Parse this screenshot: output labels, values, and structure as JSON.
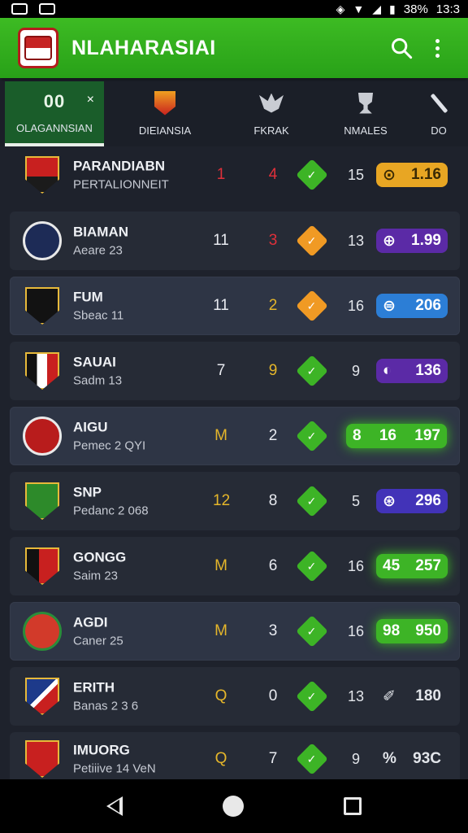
{
  "status_bar": {
    "battery": "38%",
    "time": "13:3"
  },
  "app_bar": {
    "title": "NLAHARASIAI"
  },
  "tabs": [
    {
      "label": "OLAGANNSIAN",
      "badge": "00",
      "close": "×"
    },
    {
      "label": "DIEIANSIA"
    },
    {
      "label": "FKRAK"
    },
    {
      "label": "NMALES"
    },
    {
      "label": "DO"
    }
  ],
  "rows": [
    {
      "name": "PARANDIABN",
      "sub": "PERTALIONNEIT",
      "c1": "1",
      "c2": "4",
      "diamond_glyph": "✓",
      "c3": "15",
      "pill_icon": "⊙",
      "pill_value": "1.16",
      "pill_color": "#e8a623"
    },
    {
      "name": "BIAMAN",
      "sub": "Aeare 23",
      "c1": "11",
      "c2": "3",
      "diamond_glyph": "✓",
      "c3": "13",
      "pill_icon": "⊕",
      "pill_value": "1.99",
      "pill_color": "#5b2aa6"
    },
    {
      "name": "FUM",
      "sub": "Sbeac 11",
      "c1": "11",
      "c2": "2",
      "diamond_glyph": "✓",
      "c3": "16",
      "pill_icon": "⊜",
      "pill_value": "206",
      "pill_color": "#2c7ed6"
    },
    {
      "name": "SAUAI",
      "sub": "Sadm 13",
      "c1": "7",
      "c2": "9",
      "diamond_glyph": "✓",
      "c3": "9",
      "pill_icon": "◐",
      "pill_value": "136",
      "pill_color": "#5b2aa6"
    },
    {
      "name": "AIGU",
      "sub": "Pemec 2 QYI",
      "c1": "M",
      "c2": "2",
      "diamond_glyph": "✓",
      "c3": "",
      "pill_icon": "8",
      "pill_mid": "16",
      "pill_value": "197",
      "pill_color": "#3db426"
    },
    {
      "name": "SNP",
      "sub": "Pedanc 2 068",
      "c1": "12",
      "c2": "8",
      "diamond_glyph": "✓",
      "c3": "5",
      "pill_icon": "⊛",
      "pill_value": "296",
      "pill_color": "#4233b8"
    },
    {
      "name": "GONGG",
      "sub": "Saim 23",
      "c1": "M",
      "c2": "6",
      "diamond_glyph": "✓",
      "c3": "16",
      "pill_icon": "45",
      "pill_value": "257",
      "pill_color": "#3db426"
    },
    {
      "name": "AGDI",
      "sub": "Caner 25",
      "c1": "M",
      "c2": "3",
      "diamond_glyph": "✓",
      "c3": "16",
      "pill_icon": "98",
      "pill_value": "950",
      "pill_color": "#3db426"
    },
    {
      "name": "ERITH",
      "sub": "Banas 2 3 6",
      "c1": "Q",
      "c2": "0",
      "diamond_glyph": "✓",
      "c3": "13",
      "pill_icon": "✐",
      "pill_value": "180",
      "pill_color": ""
    },
    {
      "name": "IMUORG",
      "sub": "Petiiive 14 VeN",
      "c1": "Q",
      "c2": "7",
      "diamond_glyph": "✓",
      "c3": "9",
      "pill_icon": "%",
      "pill_value": "93C",
      "pill_color": ""
    }
  ],
  "colors": {
    "accent_green": "#3db426",
    "red": "#e0303a",
    "orange": "#f09a24",
    "yellow": "#e5b62a"
  }
}
